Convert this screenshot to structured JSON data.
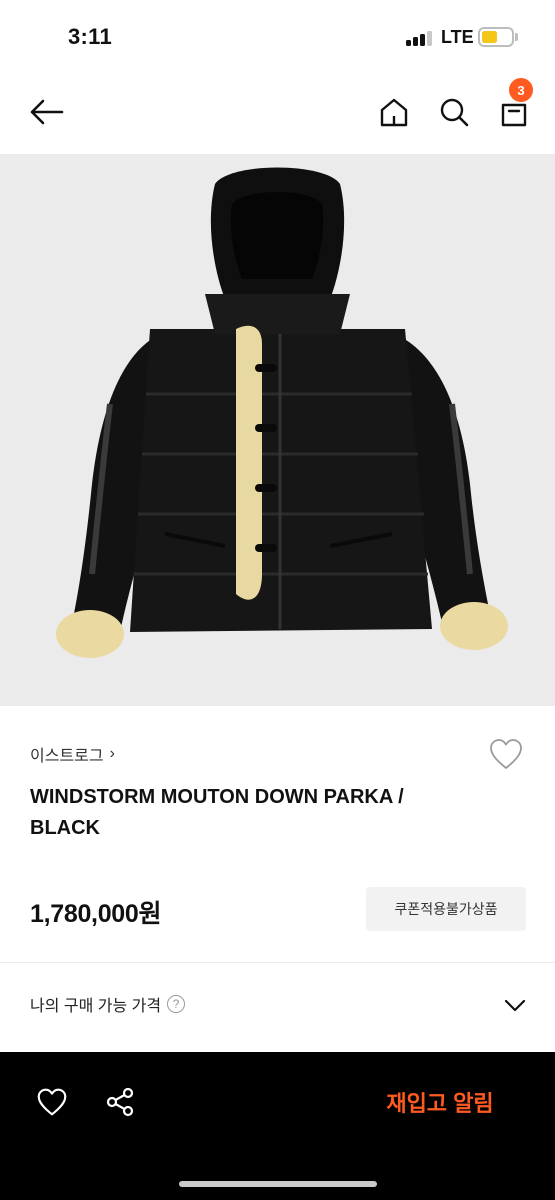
{
  "status_bar": {
    "time": "3:11",
    "network": "LTE",
    "battery_level": 0.55
  },
  "nav": {
    "back_icon": "arrow-left-icon",
    "home_icon": "home-icon",
    "search_icon": "search-icon",
    "bag_icon": "shopping-bag-icon",
    "cart_count": "3"
  },
  "product": {
    "image_alt": "black down parka with shearling trim",
    "brand": "이스트로그",
    "brand_chevron": "›",
    "title": "WINDSTORM MOUTON DOWN PARKA / BLACK",
    "price": "1,780,000원",
    "coupon_notice": "쿠폰적용불가상품",
    "my_price_label": "나의 구매 가능 가격",
    "help_glyph": "?"
  },
  "bottom_bar": {
    "wishlist_icon": "heart-icon",
    "share_icon": "share-icon",
    "restock_label": "재입고 알림"
  },
  "colors": {
    "accent": "#ff5a1f",
    "bottom_bar": "#000000",
    "image_bg": "#ebebeb"
  }
}
